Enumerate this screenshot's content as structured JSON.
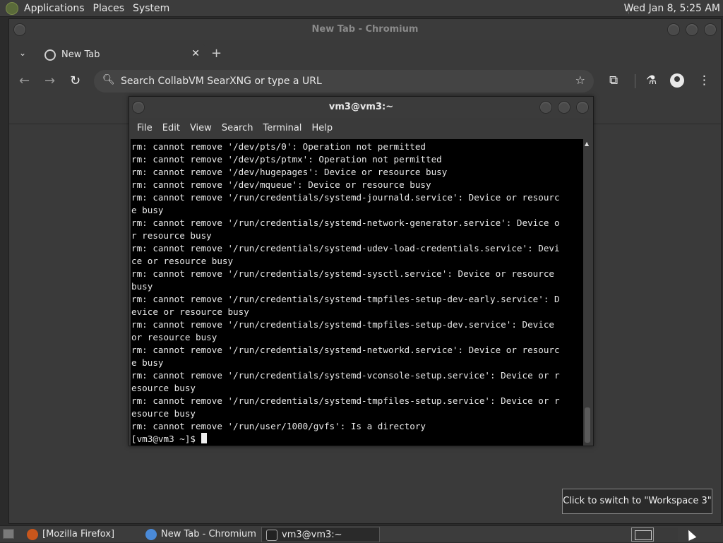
{
  "top_panel": {
    "menu": [
      "Applications",
      "Places",
      "System"
    ],
    "clock": "Wed Jan  8,  5:25 AM"
  },
  "chromium": {
    "window_title": "New Tab - Chromium",
    "tab_label": "New Tab",
    "tab_close": "✕",
    "new_tab": "+",
    "omnibox_text": "Search CollabVM SearXNG or type a URL",
    "icons": {
      "back": "←",
      "forward": "→",
      "reload": "↻",
      "search": "🔍︎",
      "star": "☆",
      "extensions": "⧉",
      "labs": "⚗",
      "menu": "⋮",
      "tab_dropdown": "⌄"
    }
  },
  "terminal": {
    "window_title": "vm3@vm3:~",
    "menu": [
      "File",
      "Edit",
      "View",
      "Search",
      "Terminal",
      "Help"
    ],
    "lines": [
      "rm: cannot remove '/dev/pts/0': Operation not permitted",
      "rm: cannot remove '/dev/pts/ptmx': Operation not permitted",
      "rm: cannot remove '/dev/hugepages': Device or resource busy",
      "rm: cannot remove '/dev/mqueue': Device or resource busy",
      "rm: cannot remove '/run/credentials/systemd-journald.service': Device or resourc",
      "e busy",
      "rm: cannot remove '/run/credentials/systemd-network-generator.service': Device o",
      "r resource busy",
      "rm: cannot remove '/run/credentials/systemd-udev-load-credentials.service': Devi",
      "ce or resource busy",
      "rm: cannot remove '/run/credentials/systemd-sysctl.service': Device or resource",
      "busy",
      "rm: cannot remove '/run/credentials/systemd-tmpfiles-setup-dev-early.service': D",
      "evice or resource busy",
      "rm: cannot remove '/run/credentials/systemd-tmpfiles-setup-dev.service': Device",
      "or resource busy",
      "rm: cannot remove '/run/credentials/systemd-networkd.service': Device or resourc",
      "e busy",
      "rm: cannot remove '/run/credentials/systemd-vconsole-setup.service': Device or r",
      "esource busy",
      "rm: cannot remove '/run/credentials/systemd-tmpfiles-setup.service': Device or r",
      "esource busy",
      "rm: cannot remove '/run/user/1000/gvfs': Is a directory"
    ],
    "prompt": "[vm3@vm3 ~]$ "
  },
  "tooltip": "Click to switch to \"Workspace 3\"",
  "taskbar": {
    "items": [
      "[Mozilla Firefox]",
      "New Tab - Chromium",
      "vm3@vm3:~"
    ]
  }
}
